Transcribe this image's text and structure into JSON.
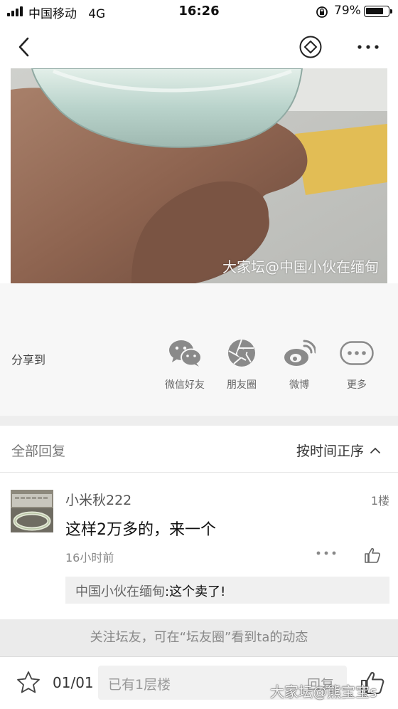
{
  "status_bar": {
    "carrier": "中国移动   4G",
    "time": "16:26",
    "battery": "79%"
  },
  "nav": {
    "back_icon": "chevron-left-icon",
    "diamond_icon": "diamond-coin-icon",
    "more_icon": "more-dots-icon"
  },
  "post": {
    "image_watermark": "大家坛@中国小伙在缅甸"
  },
  "share": {
    "label": "分享到",
    "items": [
      {
        "label": "微信好友",
        "icon": "wechat-icon"
      },
      {
        "label": "朋友圈",
        "icon": "moments-icon"
      },
      {
        "label": "微博",
        "icon": "weibo-icon"
      },
      {
        "label": "更多",
        "icon": "more-circle-icon"
      }
    ]
  },
  "replies": {
    "header": "全部回复",
    "sort": "按时间正序",
    "items": [
      {
        "username": "小米秋222",
        "floor": "1楼",
        "text": "这样2万多的，来一个",
        "time": "16小时前",
        "quote_author": "中国小伙在缅甸",
        "quote_text": ":这个卖了!"
      }
    ]
  },
  "follow_banner": "关注坛友，可在“坛友圈”看到ta的动态",
  "bottom_bar": {
    "page_counter": "01/01",
    "reply_placeholder": "已有1层楼",
    "reply_button": "回复",
    "watermark": "大家坛@熊宝宝s"
  },
  "colors": {
    "icon_gray": "#8a8a8a",
    "banner_bg": "#ebebeb",
    "divider_bg": "#eeeeee"
  }
}
